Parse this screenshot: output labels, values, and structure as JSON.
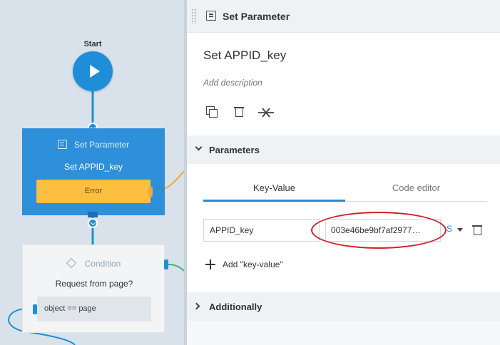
{
  "canvas": {
    "start_label": "Start",
    "set_node": {
      "type_label": "Set Parameter",
      "name": "Set APPID_key",
      "error_label": "Error"
    },
    "condition_node": {
      "type_label": "Condition",
      "question": "Request from page?",
      "expression": "object == page"
    }
  },
  "panel": {
    "header_title": "Set Parameter",
    "title": "Set APPID_key",
    "description_placeholder": "Add description",
    "parameters_label": "Parameters",
    "tabs": [
      {
        "label": "Key-Value",
        "active": true
      },
      {
        "label": "Code editor",
        "active": false
      }
    ],
    "kv_row": {
      "key": "APPID_key",
      "value": "003e46be9bf7af2977…",
      "type_label": "S"
    },
    "add_kv_label": "Add \"key-value\"",
    "additionally_label": "Additionally"
  },
  "colors": {
    "accent": "#1f8ed8",
    "error_yellow": "#fbbe3e",
    "highlight_red": "#d21f27"
  }
}
